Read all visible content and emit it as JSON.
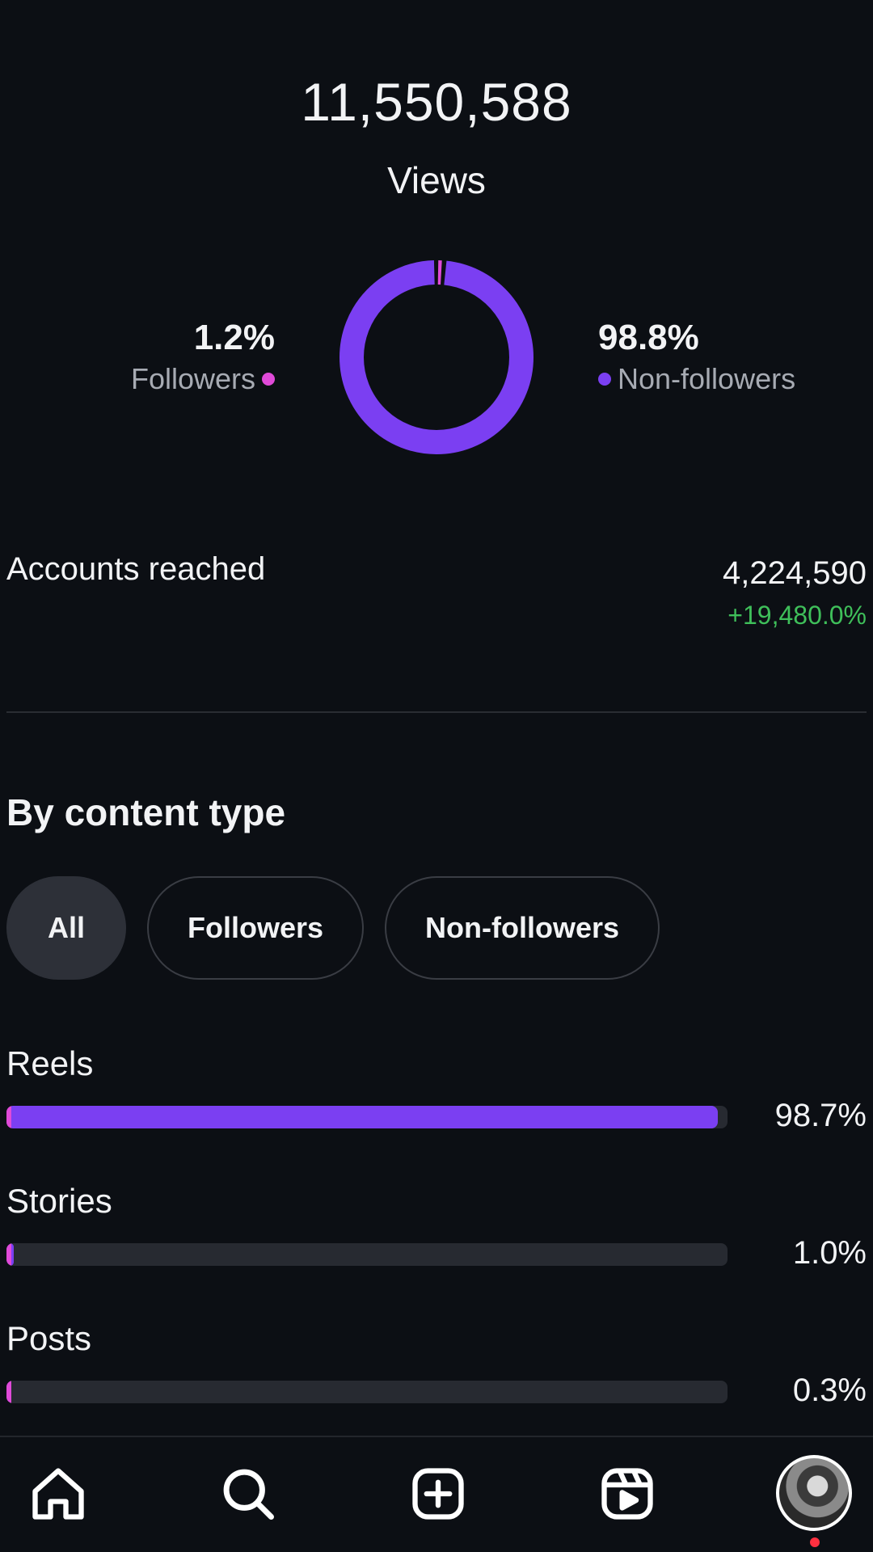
{
  "colors": {
    "background": "#0c0f14",
    "nonfollowers": "#7b3ff2",
    "followers": "#e04ad8",
    "positive": "#3fbf5a",
    "notification": "#ff3040"
  },
  "views": {
    "total": "11,550,588",
    "label": "Views",
    "followers_pct_label": "1.2%",
    "followers_label": "Followers",
    "followers_fraction": 0.012,
    "nonfollowers_pct_label": "98.8%",
    "nonfollowers_label": "Non-followers",
    "nonfollowers_fraction": 0.988
  },
  "reach": {
    "label": "Accounts reached",
    "value": "4,224,590",
    "change": "+19,480.0%"
  },
  "content_type": {
    "title": "By content type",
    "filters": [
      {
        "label": "All",
        "active": true
      },
      {
        "label": "Followers",
        "active": false
      },
      {
        "label": "Non-followers",
        "active": false
      }
    ],
    "rows": [
      {
        "label": "Reels",
        "pct_label": "98.7%",
        "share": 0.987
      },
      {
        "label": "Stories",
        "pct_label": "1.0%",
        "share": 0.01
      },
      {
        "label": "Posts",
        "pct_label": "0.3%",
        "share": 0.003
      }
    ]
  },
  "bottom_nav": {
    "items": [
      "home-icon",
      "search-icon",
      "create-icon",
      "reels-icon",
      "profile-avatar"
    ]
  }
}
